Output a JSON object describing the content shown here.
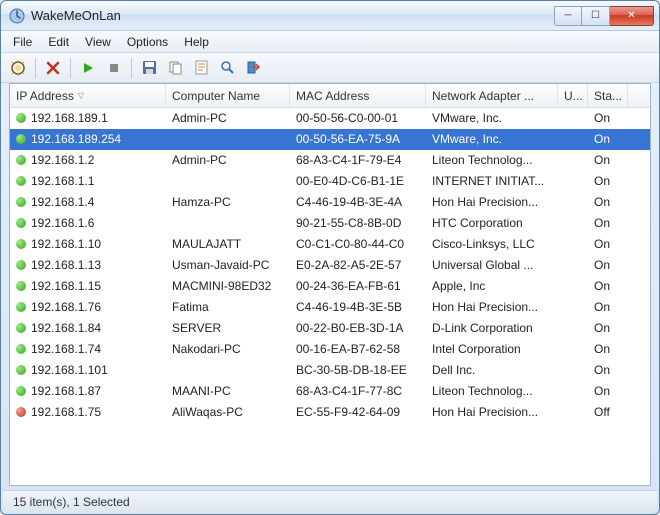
{
  "window": {
    "title": "WakeMeOnLan"
  },
  "winctl": {
    "min": "─",
    "max": "☐",
    "close": "✕"
  },
  "menu": {
    "file": "File",
    "edit": "Edit",
    "view": "View",
    "options": "Options",
    "help": "Help"
  },
  "columns": {
    "ip": "IP Address",
    "name": "Computer Name",
    "mac": "MAC Address",
    "adapter": "Network Adapter ...",
    "user": "U...",
    "status": "Sta..."
  },
  "rows": [
    {
      "dot": "green",
      "ip": "192.168.189.1",
      "name": "Admin-PC",
      "mac": "00-50-56-C0-00-01",
      "adapter": "VMware, Inc.",
      "user": "",
      "status": "On",
      "selected": false
    },
    {
      "dot": "green",
      "ip": "192.168.189.254",
      "name": "",
      "mac": "00-50-56-EA-75-9A",
      "adapter": "VMware, Inc.",
      "user": "",
      "status": "On",
      "selected": true
    },
    {
      "dot": "green",
      "ip": "192.168.1.2",
      "name": "Admin-PC",
      "mac": "68-A3-C4-1F-79-E4",
      "adapter": "Liteon Technolog...",
      "user": "",
      "status": "On",
      "selected": false
    },
    {
      "dot": "green",
      "ip": "192.168.1.1",
      "name": "",
      "mac": "00-E0-4D-C6-B1-1E",
      "adapter": "INTERNET INITIAT...",
      "user": "",
      "status": "On",
      "selected": false
    },
    {
      "dot": "green",
      "ip": "192.168.1.4",
      "name": "Hamza-PC",
      "mac": "C4-46-19-4B-3E-4A",
      "adapter": "Hon Hai Precision...",
      "user": "",
      "status": "On",
      "selected": false
    },
    {
      "dot": "green",
      "ip": "192.168.1.6",
      "name": "",
      "mac": "90-21-55-C8-8B-0D",
      "adapter": "HTC Corporation",
      "user": "",
      "status": "On",
      "selected": false
    },
    {
      "dot": "green",
      "ip": "192.168.1.10",
      "name": "MAULAJATT",
      "mac": "C0-C1-C0-80-44-C0",
      "adapter": "Cisco-Linksys, LLC",
      "user": "",
      "status": "On",
      "selected": false
    },
    {
      "dot": "green",
      "ip": "192.168.1.13",
      "name": "Usman-Javaid-PC",
      "mac": "E0-2A-82-A5-2E-57",
      "adapter": "Universal Global ...",
      "user": "",
      "status": "On",
      "selected": false
    },
    {
      "dot": "green",
      "ip": "192.168.1.15",
      "name": "MACMINI-98ED32",
      "mac": "00-24-36-EA-FB-61",
      "adapter": "Apple, Inc",
      "user": "",
      "status": "On",
      "selected": false
    },
    {
      "dot": "green",
      "ip": "192.168.1.76",
      "name": "Fatima",
      "mac": "C4-46-19-4B-3E-5B",
      "adapter": "Hon Hai Precision...",
      "user": "",
      "status": "On",
      "selected": false
    },
    {
      "dot": "green",
      "ip": "192.168.1.84",
      "name": "SERVER",
      "mac": "00-22-B0-EB-3D-1A",
      "adapter": "D-Link Corporation",
      "user": "",
      "status": "On",
      "selected": false
    },
    {
      "dot": "green",
      "ip": "192.168.1.74",
      "name": "Nakodari-PC",
      "mac": "00-16-EA-B7-62-58",
      "adapter": "Intel Corporation",
      "user": "",
      "status": "On",
      "selected": false
    },
    {
      "dot": "green",
      "ip": "192.168.1.101",
      "name": "",
      "mac": "BC-30-5B-DB-18-EE",
      "adapter": "Dell Inc.",
      "user": "",
      "status": "On",
      "selected": false
    },
    {
      "dot": "green",
      "ip": "192.168.1.87",
      "name": "MAANI-PC",
      "mac": "68-A3-C4-1F-77-8C",
      "adapter": "Liteon Technolog...",
      "user": "",
      "status": "On",
      "selected": false
    },
    {
      "dot": "red",
      "ip": "192.168.1.75",
      "name": "AliWaqas-PC",
      "mac": "EC-55-F9-42-64-09",
      "adapter": "Hon Hai Precision...",
      "user": "",
      "status": "Off",
      "selected": false
    }
  ],
  "status": "15 item(s), 1 Selected"
}
